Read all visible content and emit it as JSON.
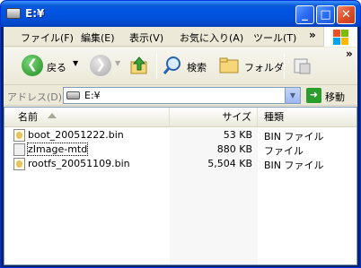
{
  "window": {
    "title": "E:¥"
  },
  "menubar": {
    "items": [
      "ファイル(F)",
      "編集(E)",
      "表示(V)",
      "お気に入り(A)",
      "ツール(T)"
    ],
    "overflow": "»"
  },
  "toolbar": {
    "back_label": "戻る",
    "search_label": "検索",
    "folders_label": "フォルダ",
    "overflow": "»"
  },
  "address": {
    "label": "アドレス(D)",
    "value": "E:¥",
    "go_label": "移動"
  },
  "columns": {
    "name": "名前",
    "size": "サイズ",
    "type": "種類"
  },
  "files": [
    {
      "name": "boot_20051222.bin",
      "size": "53 KB",
      "type": "BIN ファイル"
    },
    {
      "name": "zImage-mtd",
      "size": "880 KB",
      "type": "ファイル"
    },
    {
      "name": "rootfs_20051109.bin",
      "size": "5,504 KB",
      "type": "BIN ファイル"
    }
  ],
  "colors": {
    "titlebar": "#0054e3",
    "accent": "#0831d9"
  }
}
